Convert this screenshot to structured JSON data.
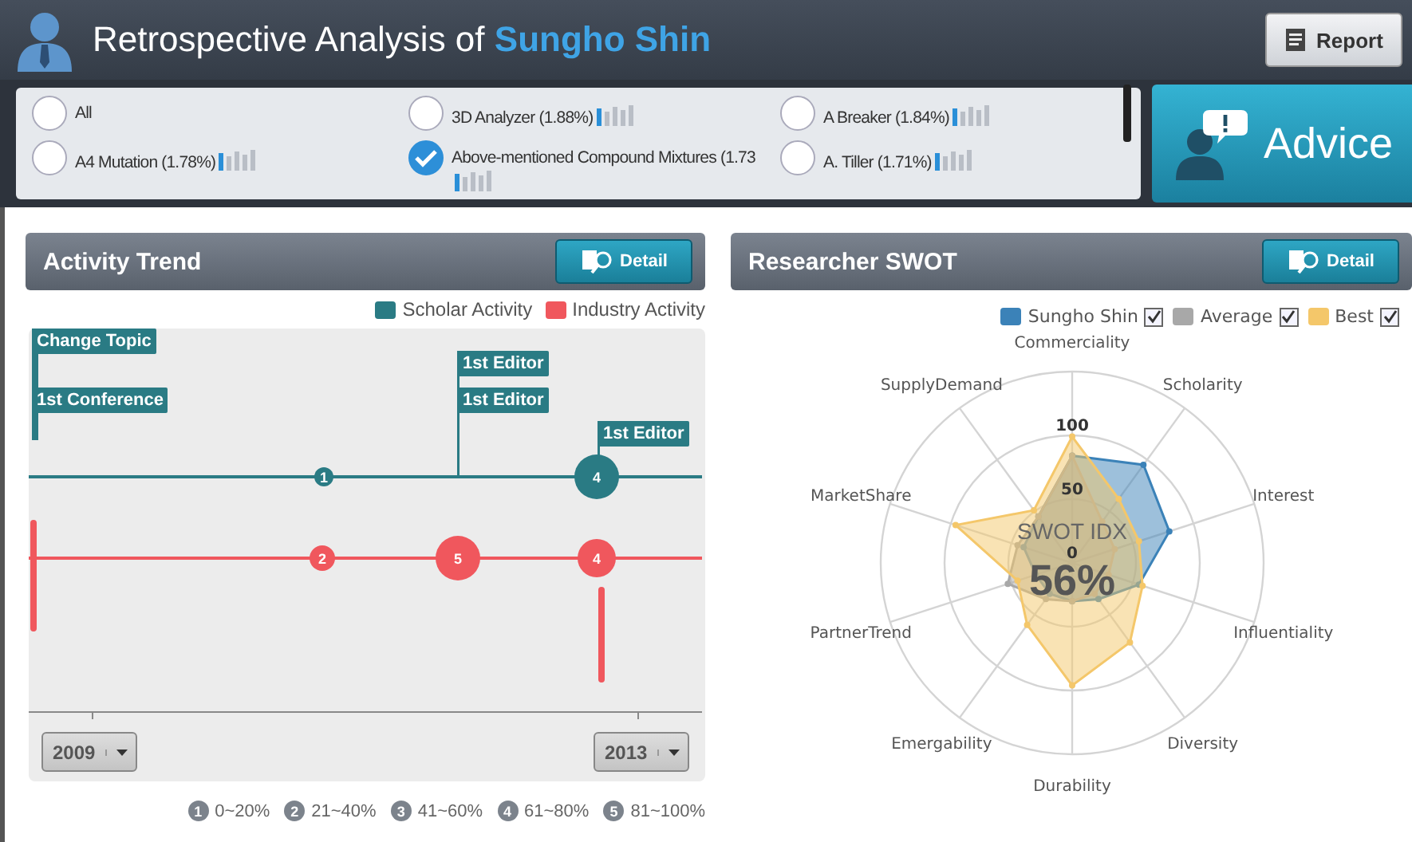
{
  "header": {
    "title_prefix": "Retrospective Analysis of",
    "title_name": "Sungho Shin",
    "report_button": "Report"
  },
  "filters": [
    {
      "label": "All",
      "kind": "all",
      "selected": false
    },
    {
      "label": "3D Analyzer (1.88%)",
      "kind": "topic",
      "selected": false
    },
    {
      "label": "A Breaker (1.84%)",
      "kind": "topic",
      "selected": false
    },
    {
      "label": "A4 Mutation (1.78%)",
      "kind": "topic",
      "selected": false
    },
    {
      "label": "Above-mentioned Compound Mixtures (1.73",
      "kind": "topic",
      "selected": true
    },
    {
      "label": "A. Tiller (1.71%)",
      "kind": "topic",
      "selected": false
    }
  ],
  "advice_button": "Advice",
  "activity_trend": {
    "title": "Activity Trend",
    "detail_button": "Detail",
    "legend": [
      {
        "label": "Scholar Activity",
        "color": "#2a7b84"
      },
      {
        "label": "Industry Activity",
        "color": "#f0575d"
      }
    ],
    "events": [
      "Change Topic",
      "1st Conference",
      "1st Editor",
      "1st Editor",
      "1st Editor"
    ],
    "scholar_bubbles": [
      "1",
      "4"
    ],
    "industry_bubbles": [
      "2",
      "5",
      "4"
    ],
    "start_year": "2009",
    "end_year": "2013",
    "scale": [
      {
        "number": "1",
        "label": "0~20%"
      },
      {
        "number": "2",
        "label": "21~40%"
      },
      {
        "number": "3",
        "label": "41~60%"
      },
      {
        "number": "4",
        "label": "61~80%"
      },
      {
        "number": "5",
        "label": "81~100%"
      }
    ]
  },
  "swot": {
    "title": "Researcher SWOT",
    "detail_button": "Detail",
    "center_label": "SWOT IDX",
    "center_value": "56%",
    "axes": [
      "Commerciality",
      "Scholarity",
      "Interest",
      "Influentiality",
      "Diversity",
      "Durability",
      "Emergability",
      "PartnerTrend",
      "MarketShare",
      "SupplyDemand"
    ],
    "ticks": [
      "100",
      "50",
      "0"
    ],
    "series": [
      {
        "name": "Sungho Shin",
        "color": "#3b82b8",
        "checked": true
      },
      {
        "name": "Average",
        "color": "#a8a8a8",
        "checked": true
      },
      {
        "name": "Best",
        "color": "#f4c76a",
        "checked": true
      }
    ]
  }
}
